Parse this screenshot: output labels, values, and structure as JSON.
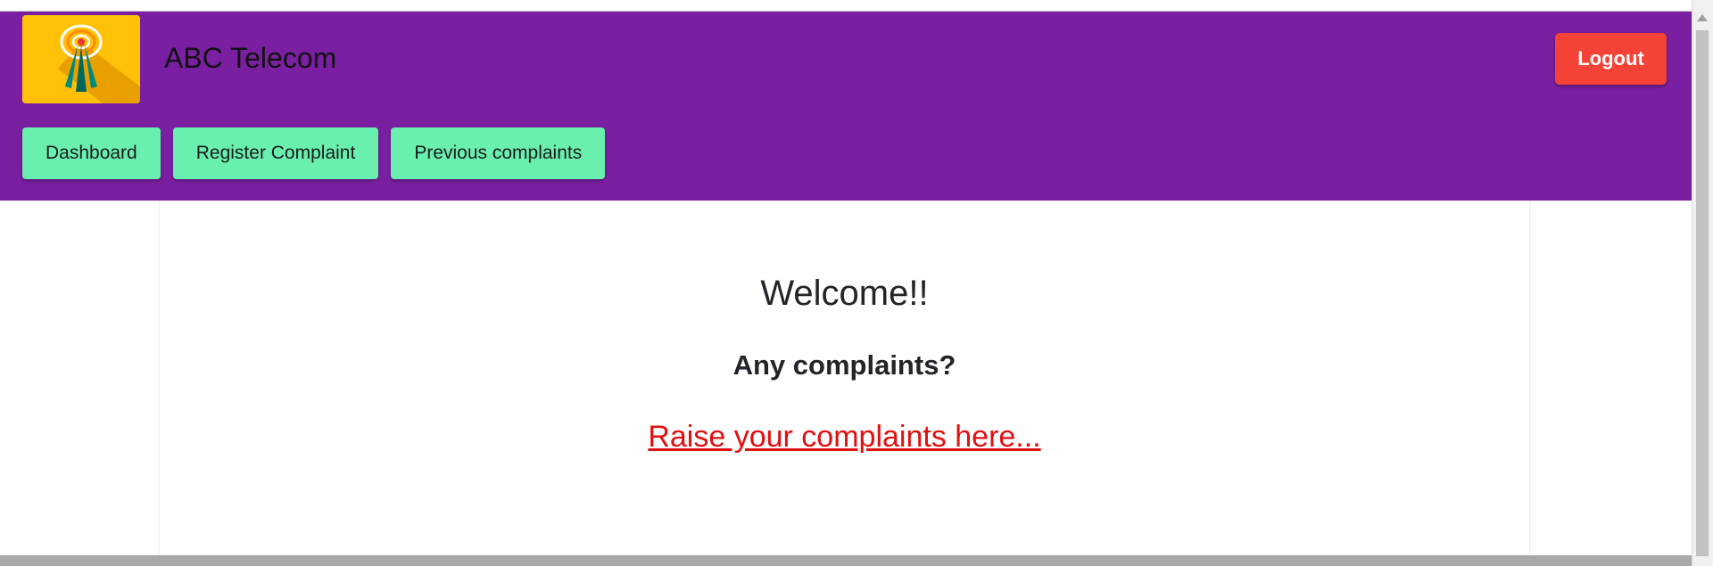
{
  "header": {
    "brand": "ABC Telecom",
    "logout_label": "Logout",
    "logo_icon": "antenna-broadcast-icon"
  },
  "nav": {
    "items": [
      {
        "label": "Dashboard"
      },
      {
        "label": "Register Complaint"
      },
      {
        "label": "Previous complaints"
      }
    ]
  },
  "main": {
    "welcome": "Welcome!!",
    "question": "Any complaints?",
    "link_text": "Raise your complaints here..."
  },
  "colors": {
    "header_bg": "#7b1fa2",
    "nav_button": "#69f0ae",
    "logout_button": "#f44336",
    "link": "#e01010"
  }
}
